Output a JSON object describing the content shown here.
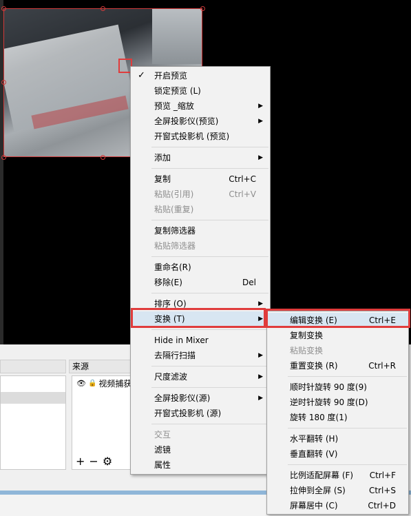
{
  "docks": {
    "sources_title": "来源"
  },
  "sources": {
    "items": [
      {
        "label": "视频捕获"
      }
    ],
    "toolbar": {
      "add": "+",
      "remove": "−",
      "settings": "⚙"
    }
  },
  "main_menu": {
    "items": [
      {
        "label": "开启预览",
        "checked": true
      },
      {
        "label": "锁定预览 (L)"
      },
      {
        "label": "预览 _缩放",
        "submenu": true
      },
      {
        "label": "全屏投影仪(预览)",
        "submenu": true
      },
      {
        "label": "开窗式投影机 (预览)"
      },
      {
        "label": "添加",
        "submenu": true
      },
      {
        "label": "复制",
        "shortcut": "Ctrl+C"
      },
      {
        "label": "粘贴(引用)",
        "shortcut": "Ctrl+V",
        "disabled": true
      },
      {
        "label": "粘贴(重复)",
        "disabled": true
      },
      {
        "label": "复制筛选器"
      },
      {
        "label": "粘贴筛选器",
        "disabled": true
      },
      {
        "label": "重命名(R)"
      },
      {
        "label": "移除(E)",
        "shortcut": "Del"
      },
      {
        "label": "排序 (O)",
        "submenu": true
      },
      {
        "label": "变换 (T)",
        "submenu": true,
        "highlighted": true
      },
      {
        "label": "Hide in Mixer"
      },
      {
        "label": "去隔行扫描",
        "submenu": true
      },
      {
        "label": "尺度滤波",
        "submenu": true
      },
      {
        "label": "全屏投影仪(源)",
        "submenu": true
      },
      {
        "label": "开窗式投影机 (源)"
      },
      {
        "label": "交互",
        "disabled": true
      },
      {
        "label": "滤镜"
      },
      {
        "label": "属性"
      }
    ]
  },
  "transform_menu": {
    "items": [
      {
        "label": "编辑变换 (E)",
        "shortcut": "Ctrl+E",
        "highlighted": true
      },
      {
        "label": "复制变换"
      },
      {
        "label": "粘贴变换",
        "disabled": true
      },
      {
        "label": "重置变换 (R)",
        "shortcut": "Ctrl+R"
      },
      {
        "label": "顺时针旋转 90 度(9)"
      },
      {
        "label": "逆时针旋转 90 度(D)"
      },
      {
        "label": "旋转 180 度(1)"
      },
      {
        "label": "水平翻转 (H)"
      },
      {
        "label": "垂直翻转 (V)"
      },
      {
        "label": "比例适配屏幕 (F)",
        "shortcut": "Ctrl+F"
      },
      {
        "label": "拉伸到全屏 (S)",
        "shortcut": "Ctrl+S"
      },
      {
        "label": "屏幕居中 (C)",
        "shortcut": "Ctrl+D"
      }
    ]
  },
  "icons": {
    "check": "✓",
    "arrow": "▶",
    "eye": "👁",
    "lock": "🔒"
  }
}
